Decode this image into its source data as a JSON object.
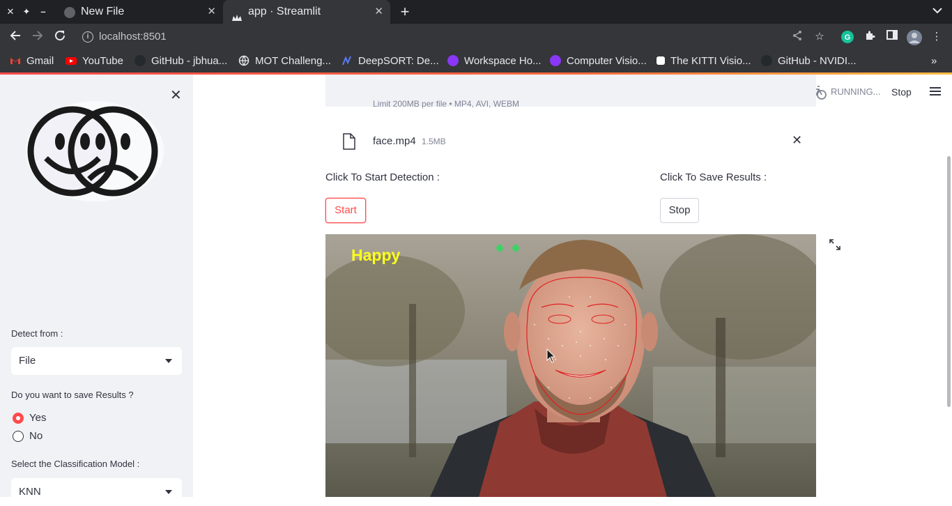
{
  "browser": {
    "window_controls": [
      "✕",
      "✦",
      "–"
    ],
    "tabs": [
      {
        "title": "New File",
        "active": false
      },
      {
        "title": "app · Streamlit",
        "active": true
      }
    ],
    "url": "localhost:8501",
    "bookmarks": [
      {
        "label": "Gmail",
        "icon": "gmail-icon",
        "color": "#ea4335"
      },
      {
        "label": "YouTube",
        "icon": "youtube-icon",
        "color": "#ff0000"
      },
      {
        "label": "GitHub - jbhua...",
        "icon": "github-icon",
        "color": "#24292e"
      },
      {
        "label": "MOT Challeng...",
        "icon": "globe-icon",
        "color": "#e8eaed"
      },
      {
        "label": "DeepSORT: De...",
        "icon": "paperswithcode-icon",
        "color": "#3b5bdb"
      },
      {
        "label": "Workspace Ho...",
        "icon": "roboflow-icon",
        "color": "#8a38f5"
      },
      {
        "label": "Computer Visio...",
        "icon": "roboflow-icon",
        "color": "#8a38f5"
      },
      {
        "label": "The KITTI Visio...",
        "icon": "kitti-icon",
        "color": "#ffffff"
      },
      {
        "label": "GitHub - NVIDI...",
        "icon": "github-icon",
        "color": "#24292e"
      }
    ]
  },
  "header": {
    "status": "RUNNING...",
    "stop_label": "Stop"
  },
  "sidebar": {
    "detect_label": "Detect from :",
    "detect_value": "File",
    "save_label": "Do you want to save Results ?",
    "save_options": [
      {
        "label": "Yes",
        "selected": true
      },
      {
        "label": "No",
        "selected": false
      }
    ],
    "model_label": "Select the Classification Model :",
    "model_value": "KNN"
  },
  "uploader": {
    "hint": "Limit 200MB per file • MP4, AVI, WEBM",
    "file_name": "face.mp4",
    "file_size": "1.5MB"
  },
  "controls": {
    "start_label": "Click To Start Detection :",
    "start_button": "Start",
    "save_label": "Click To Save Results :",
    "stop_button": "Stop"
  },
  "video": {
    "emotion_label": "Happy"
  },
  "colors": {
    "accent": "#ff4b4b",
    "sidebar_bg": "#f0f2f6",
    "text": "#31333f",
    "muted": "#808495",
    "emotion_text": "#ffff1a"
  }
}
